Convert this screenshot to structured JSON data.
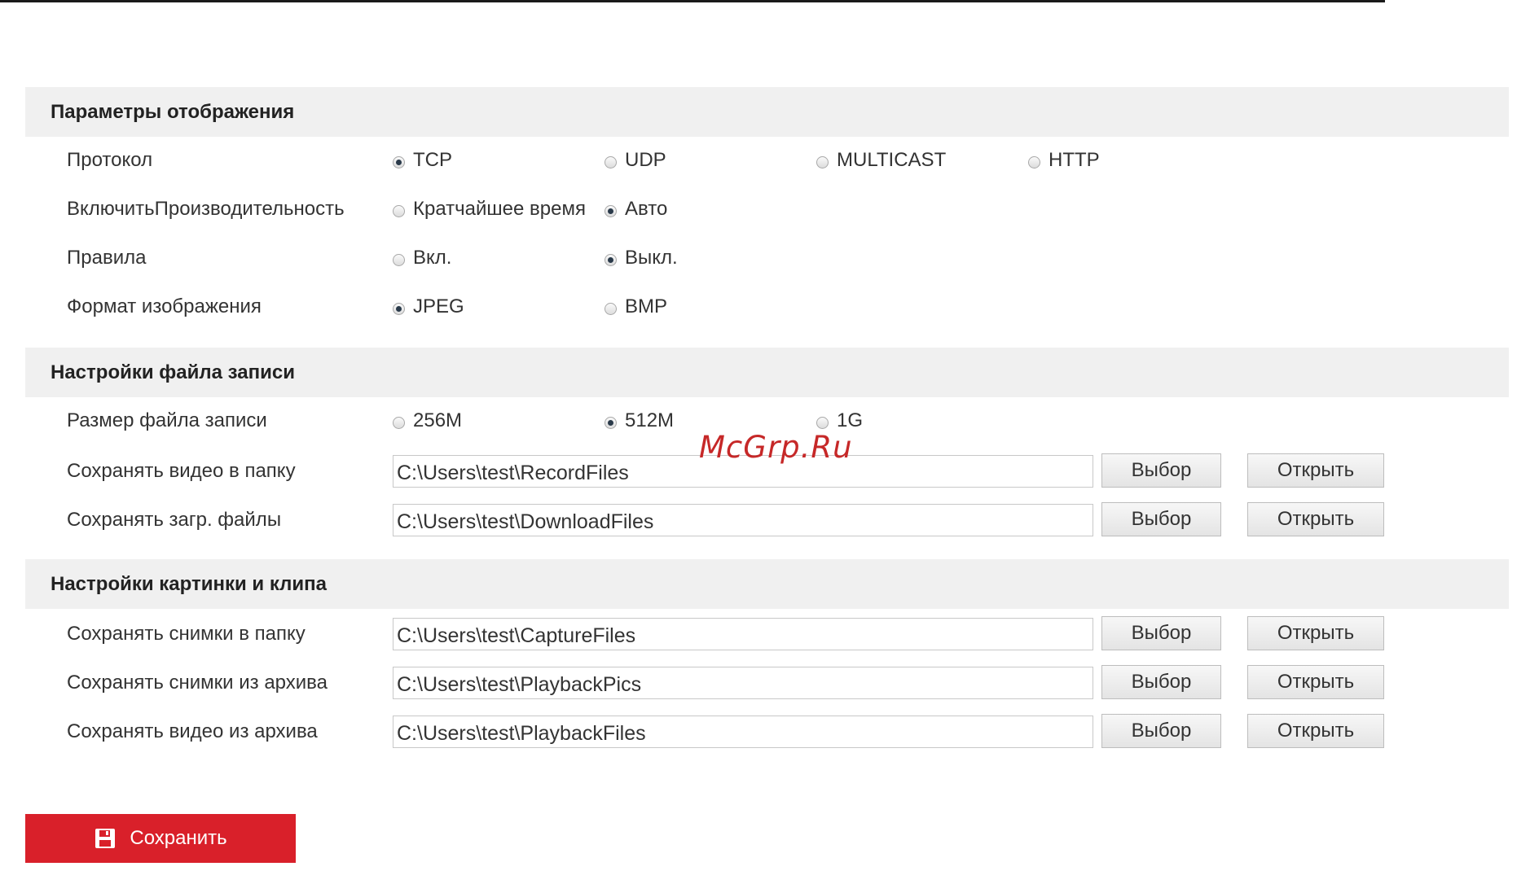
{
  "watermark": "McGrp.Ru",
  "sections": {
    "display": {
      "title": "Параметры отображения",
      "rows": {
        "protocol": {
          "label": "Протокол",
          "options": [
            "TCP",
            "UDP",
            "MULTICAST",
            "HTTP"
          ],
          "selected": "TCP"
        },
        "performance": {
          "label": "ВключитьПроизводительность",
          "options": [
            "Кратчайшее время",
            "Авто"
          ],
          "selected": "Авто"
        },
        "rules": {
          "label": "Правила",
          "options": [
            "Вкл.",
            "Выкл."
          ],
          "selected": "Выкл."
        },
        "image_format": {
          "label": "Формат изображения",
          "options": [
            "JPEG",
            "BMP"
          ],
          "selected": "JPEG"
        }
      }
    },
    "record": {
      "title": "Настройки файла записи",
      "rows": {
        "file_size": {
          "label": "Размер файла записи",
          "options": [
            "256M",
            "512M",
            "1G"
          ],
          "selected": "512M"
        },
        "video_folder": {
          "label": "Сохранять видео в папку",
          "value": "C:\\Users\\test\\RecordFiles"
        },
        "download_folder": {
          "label": "Сохранять загр. файлы",
          "value": "C:\\Users\\test\\DownloadFiles"
        }
      }
    },
    "capture": {
      "title": "Настройки картинки и клипа",
      "rows": {
        "snapshot_folder": {
          "label": "Сохранять снимки в папку",
          "value": "C:\\Users\\test\\CaptureFiles"
        },
        "playback_snapshot_folder": {
          "label": "Сохранять снимки из архива",
          "value": "C:\\Users\\test\\PlaybackPics"
        },
        "playback_video_folder": {
          "label": "Сохранять видео из архива",
          "value": "C:\\Users\\test\\PlaybackFiles"
        }
      }
    }
  },
  "buttons": {
    "choose": "Выбор",
    "open": "Открыть",
    "save": "Сохранить"
  },
  "colors": {
    "save_button": "#d9202a",
    "section_header_bg": "#f0f0f0"
  },
  "icons": {
    "save": "floppy-disk-icon"
  }
}
